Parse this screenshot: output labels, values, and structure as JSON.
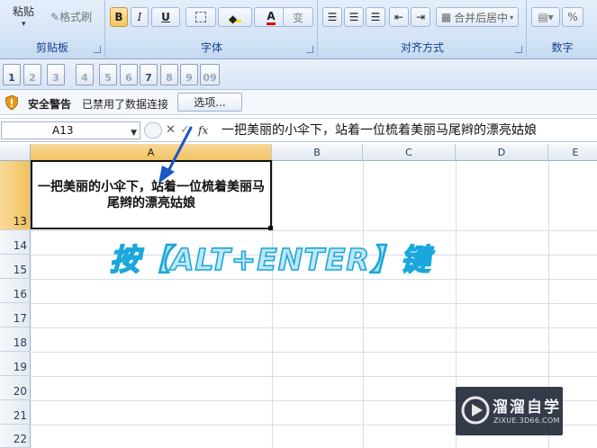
{
  "ribbon": {
    "paste_label": "粘贴",
    "format_painter_label": "格式刷",
    "groups": {
      "clipboard": "剪贴板",
      "font": "字体",
      "alignment": "对齐方式",
      "number": "数字"
    },
    "bold_label": "B",
    "italic_label": "I",
    "underline_label": "U",
    "font_color_label": "A",
    "phonetic_label": "变",
    "merge_center_label": "合并后居中",
    "percent_label": "%"
  },
  "qat": {
    "items": [
      "1",
      "2",
      "3",
      "4",
      "5",
      "6",
      "7",
      "8",
      "9",
      "09"
    ]
  },
  "security_bar": {
    "title": "安全警告",
    "message": "已禁用了数据连接",
    "options_label": "选项..."
  },
  "formula_bar": {
    "name_box": "A13",
    "fx_label": "fx",
    "cancel_label": "✕",
    "enter_label": "✓",
    "content": "一把美丽的小伞下，站着一位梳着美丽马尾辫的漂亮姑娘"
  },
  "grid": {
    "columns": [
      "A",
      "B",
      "C",
      "D",
      "E"
    ],
    "rows": [
      "13",
      "14",
      "15",
      "16",
      "17",
      "18",
      "19",
      "20",
      "21",
      "22"
    ],
    "selected_cell": "A13",
    "cell_a13_text": "一把美丽的小伞下，站着一位梳着美丽马尾辫的漂亮姑娘"
  },
  "annotation": "按【ALT+ENTER】键",
  "watermark": {
    "title": "溜溜自学",
    "url": "ZIXUE.3D66.COM"
  },
  "colors": {
    "accent_blue": "#1a56c6",
    "annotation_stroke": "#1aa8dc",
    "selected_header": "#f1c15f"
  }
}
